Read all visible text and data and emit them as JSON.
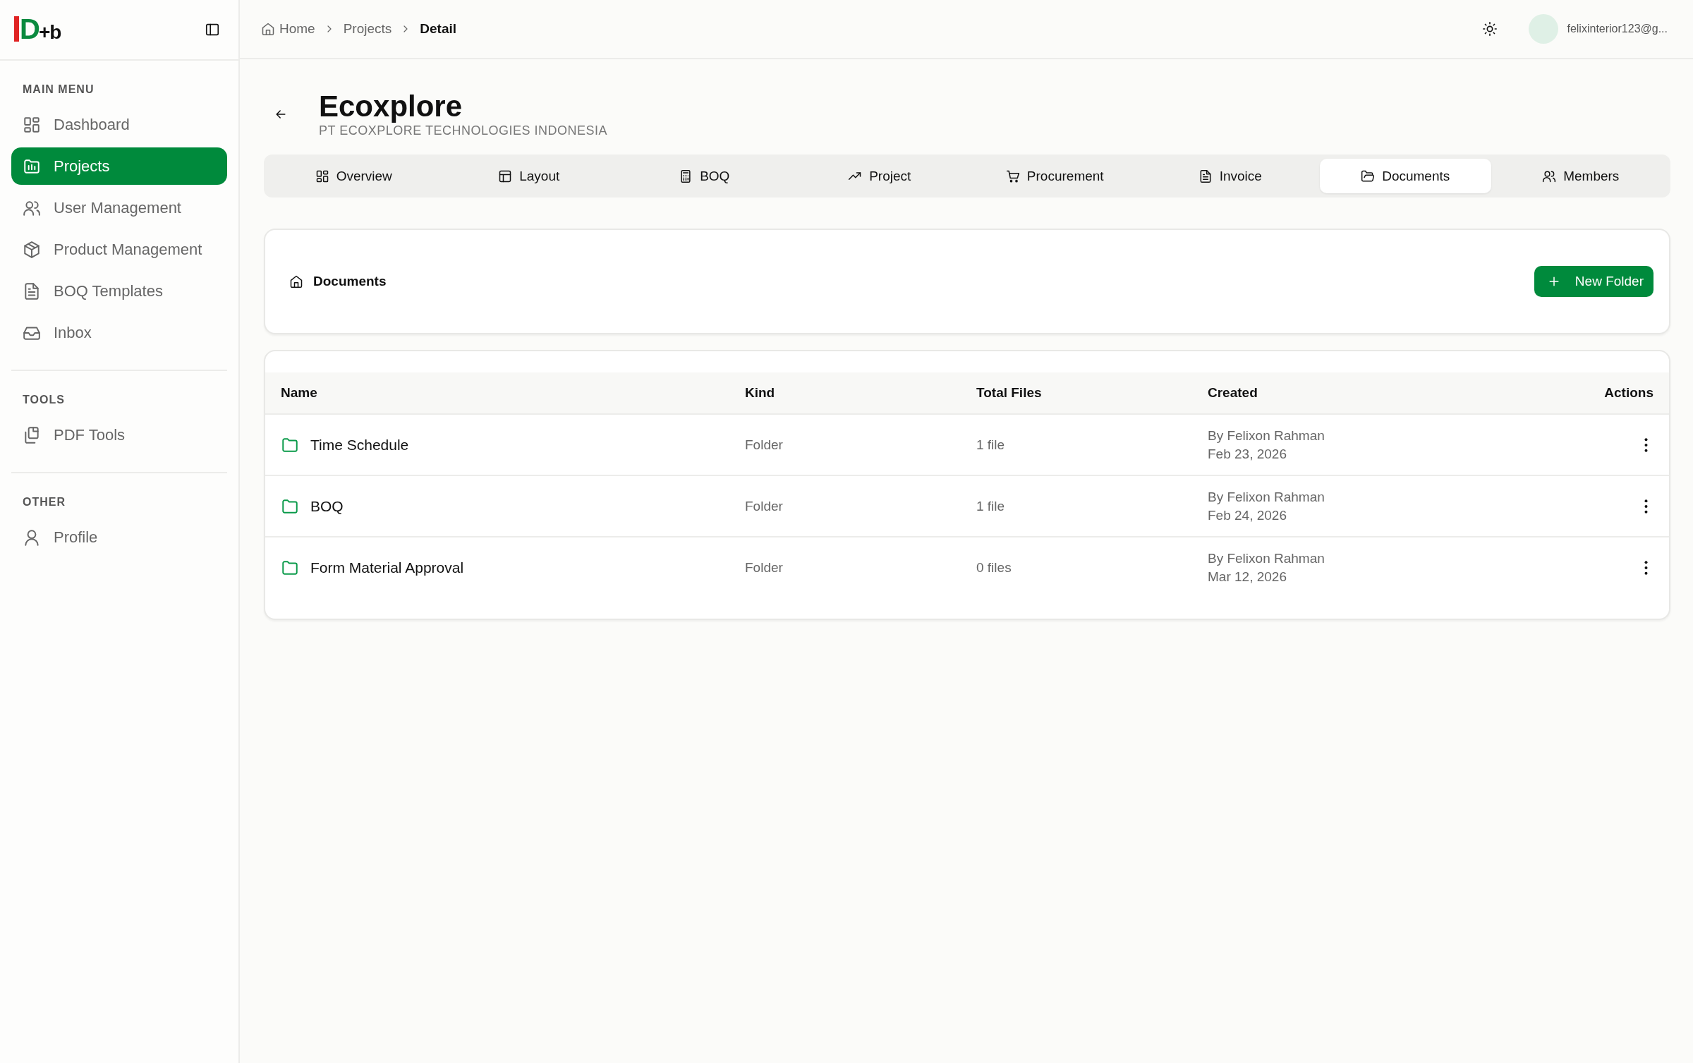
{
  "sidebar": {
    "logo": {
      "main": "D",
      "suffix": "+b"
    },
    "sections": [
      {
        "heading": "MAIN MENU",
        "items": [
          {
            "label": "Dashboard",
            "selected": false
          },
          {
            "label": "Projects",
            "selected": true
          },
          {
            "label": "User Management",
            "selected": false
          },
          {
            "label": "Product Management",
            "selected": false
          },
          {
            "label": "BOQ Templates",
            "selected": false
          },
          {
            "label": "Inbox",
            "selected": false
          }
        ]
      },
      {
        "heading": "TOOLS",
        "items": [
          {
            "label": "PDF Tools",
            "selected": false
          }
        ]
      },
      {
        "heading": "OTHER",
        "items": [
          {
            "label": "Profile",
            "selected": false
          }
        ]
      }
    ]
  },
  "breadcrumb": [
    {
      "label": "Home",
      "current": false
    },
    {
      "label": "Projects",
      "current": false
    },
    {
      "label": "Detail",
      "current": true
    }
  ],
  "user": {
    "email": "felixinterior123@g..."
  },
  "project": {
    "title": "Ecoxplore",
    "subtitle": "PT ECOXPLORE TECHNOLOGIES INDONESIA"
  },
  "tabs": [
    {
      "label": "Overview",
      "selected": false
    },
    {
      "label": "Layout",
      "selected": false
    },
    {
      "label": "BOQ",
      "selected": false
    },
    {
      "label": "Project",
      "selected": false
    },
    {
      "label": "Procurement",
      "selected": false
    },
    {
      "label": "Invoice",
      "selected": false
    },
    {
      "label": "Documents",
      "selected": true
    },
    {
      "label": "Members",
      "selected": false
    }
  ],
  "folder_path": {
    "label": "Documents"
  },
  "new_folder_button": "New Folder",
  "table": {
    "columns": [
      "Name",
      "Kind",
      "Total Files",
      "Created",
      "Actions"
    ],
    "rows": [
      {
        "name": "Time Schedule",
        "kind": "Folder",
        "total_files": "1 file",
        "created_by": "By Felixon Rahman",
        "created_on": "Feb 23, 2026"
      },
      {
        "name": "BOQ",
        "kind": "Folder",
        "total_files": "1 file",
        "created_by": "By Felixon Rahman",
        "created_on": "Feb 24, 2026"
      },
      {
        "name": "Form Material Approval",
        "kind": "Folder",
        "total_files": "0 files",
        "created_by": "By Felixon Rahman",
        "created_on": "Mar 12, 2026"
      }
    ]
  }
}
